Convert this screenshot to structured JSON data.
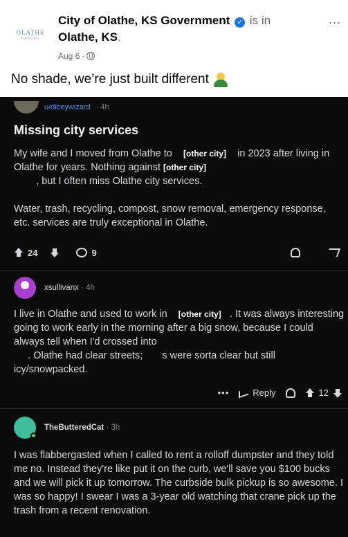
{
  "facebook": {
    "page_name": "City of Olathe, KS Government",
    "is_in": "is in",
    "location": "Olathe, KS",
    "location_suffix": ".",
    "date": "Aug 6",
    "separator": "·",
    "caption": "No shade, we’re just built different",
    "more_icon": "...",
    "logo_text": "OLATHE",
    "logo_sub": "KANSAS"
  },
  "post": {
    "author": "u/diceywizard",
    "time": "· 4h",
    "title": "Missing city services",
    "p1_a": "My wife and I moved from Olathe to",
    "redact1": "[other city]",
    "p1_b": "in 2023 after living in Olathe for years. Nothing against",
    "redact2": "[other city]",
    "p1_c": ", but I often miss Olathe city services.",
    "p2": "Water, trash, recycling, compost, snow removal, emergency response, etc. services are truly exceptional in Olathe.",
    "upvotes": "24",
    "comments": "9"
  },
  "comments": [
    {
      "author": "xsullivanx",
      "time": "· 4h",
      "body_a": "I live in Olathe and used to work in",
      "redact": "[other city]",
      "body_b": ". It was always interesting going to work early in the morning after a big snow, because I could always tell when I'd crossed into",
      "body_c": ". Olathe had clear streets;",
      "body_d": "s were sorta clear but still icy/snowpacked.",
      "reply_label": "Reply",
      "votes": "12"
    },
    {
      "author": "TheButteredCat",
      "time": "· 3h",
      "body": "I was flabbergasted when I called to rent a rolloff dumpster and they told me no. Instead they're like put it on the curb, we'll save you $100 bucks and we will pick it up tomorrow. The curbside bulk pickup is so awesome. I was so happy! I swear I was a 3-year old watching that crane pick up the trash from a recent renovation."
    }
  ]
}
